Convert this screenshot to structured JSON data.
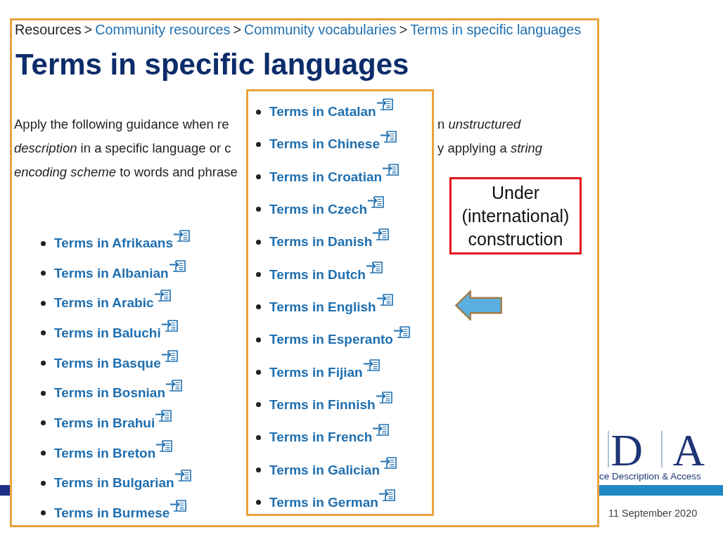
{
  "breadcrumb": [
    {
      "kind": "plain",
      "label": "Resources"
    },
    {
      "kind": "separator",
      "label": ">"
    },
    {
      "kind": "link",
      "label": "Community resources"
    },
    {
      "kind": "separator",
      "label": ">"
    },
    {
      "kind": "link",
      "label": "Community vocabularies"
    },
    {
      "kind": "separator",
      "label": ">"
    },
    {
      "kind": "link",
      "label": "Terms in specific languages"
    }
  ],
  "heading": "Terms in specific languages",
  "intro_fragments": [
    {
      "left": "Apply the following guidance when re",
      "right": "n *unstructured*"
    },
    {
      "left": "*description* in a specific language or c",
      "right": "y applying a *string*"
    },
    {
      "left": "*encoding scheme* to words and phrase"
    }
  ],
  "language_links": [
    "Terms in Afrikaans",
    "Terms in Albanian",
    "Terms in Arabic",
    "Terms in Baluchi",
    "Terms in Basque",
    "Terms in Bosnian",
    "Terms in Brahui",
    "Terms in Breton",
    "Terms in Bulgarian",
    "Terms in Burmese"
  ],
  "overlay_language_links": [
    "Terms in Catalan",
    "Terms in Chinese",
    "Terms in Croatian",
    "Terms in Czech",
    "Terms in Danish",
    "Terms in Dutch",
    "Terms in English",
    "Terms in Esperanto",
    "Terms in Fijian",
    "Terms in Finnish",
    "Terms in French",
    "Terms in Galician",
    "Terms in German"
  ],
  "notice": "Under (international) construction",
  "logo": {
    "letters": [
      "D",
      "A"
    ],
    "tagline": "ce Description & Access"
  },
  "date": "11 September 2020"
}
